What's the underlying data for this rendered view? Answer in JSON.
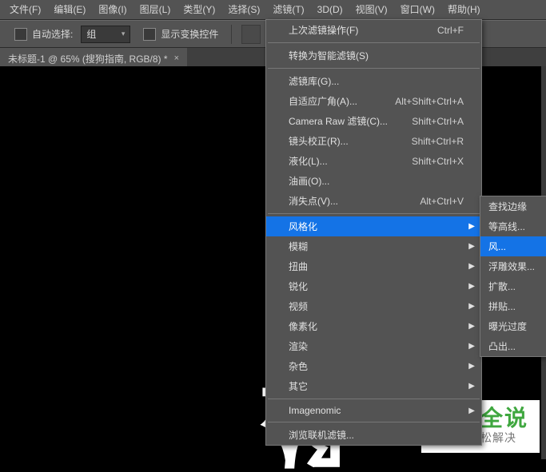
{
  "menubar": {
    "items": [
      "文件(F)",
      "编辑(E)",
      "图像(I)",
      "图层(L)",
      "类型(Y)",
      "选择(S)",
      "滤镜(T)",
      "3D(D)",
      "视图(V)",
      "窗口(W)",
      "帮助(H)"
    ]
  },
  "toolbar": {
    "auto_select": "自动选择:",
    "group_option": "组",
    "show_transform": "显示变换控件"
  },
  "document_tab": {
    "title": "未标题-1 @ 65% (搜狗指南, RGB/8) *",
    "close": "×"
  },
  "filter_menu": {
    "last_filter": {
      "label": "上次滤镜操作(F)",
      "shortcut": "Ctrl+F"
    },
    "smart": {
      "label": "转换为智能滤镜(S)"
    },
    "gallery": {
      "label": "滤镜库(G)..."
    },
    "adaptive": {
      "label": "自适应广角(A)...",
      "shortcut": "Alt+Shift+Ctrl+A"
    },
    "camera_raw": {
      "label": "Camera Raw 滤镜(C)...",
      "shortcut": "Shift+Ctrl+A"
    },
    "lens": {
      "label": "镜头校正(R)...",
      "shortcut": "Shift+Ctrl+R"
    },
    "liquify": {
      "label": "液化(L)...",
      "shortcut": "Shift+Ctrl+X"
    },
    "oil": {
      "label": "油画(O)..."
    },
    "vanish": {
      "label": "消失点(V)...",
      "shortcut": "Alt+Ctrl+V"
    },
    "stylize": {
      "label": "风格化"
    },
    "blur": {
      "label": "模糊"
    },
    "distort": {
      "label": "扭曲"
    },
    "sharpen": {
      "label": "锐化"
    },
    "video": {
      "label": "视频"
    },
    "pixelate": {
      "label": "像素化"
    },
    "render": {
      "label": "渲染"
    },
    "noise": {
      "label": "杂色"
    },
    "other": {
      "label": "其它"
    },
    "imagenomic": {
      "label": "Imagenomic"
    },
    "browse": {
      "label": "浏览联机滤镜..."
    }
  },
  "stylize_submenu": {
    "items": [
      "查找边缘",
      "等高线...",
      "风...",
      "浮雕效果...",
      "扩散...",
      "拼贴...",
      "曝光过度",
      "凸出..."
    ]
  },
  "canvas_glyph": "坠",
  "watermark": {
    "big": "百科全说",
    "small": "助你轻松解决"
  }
}
